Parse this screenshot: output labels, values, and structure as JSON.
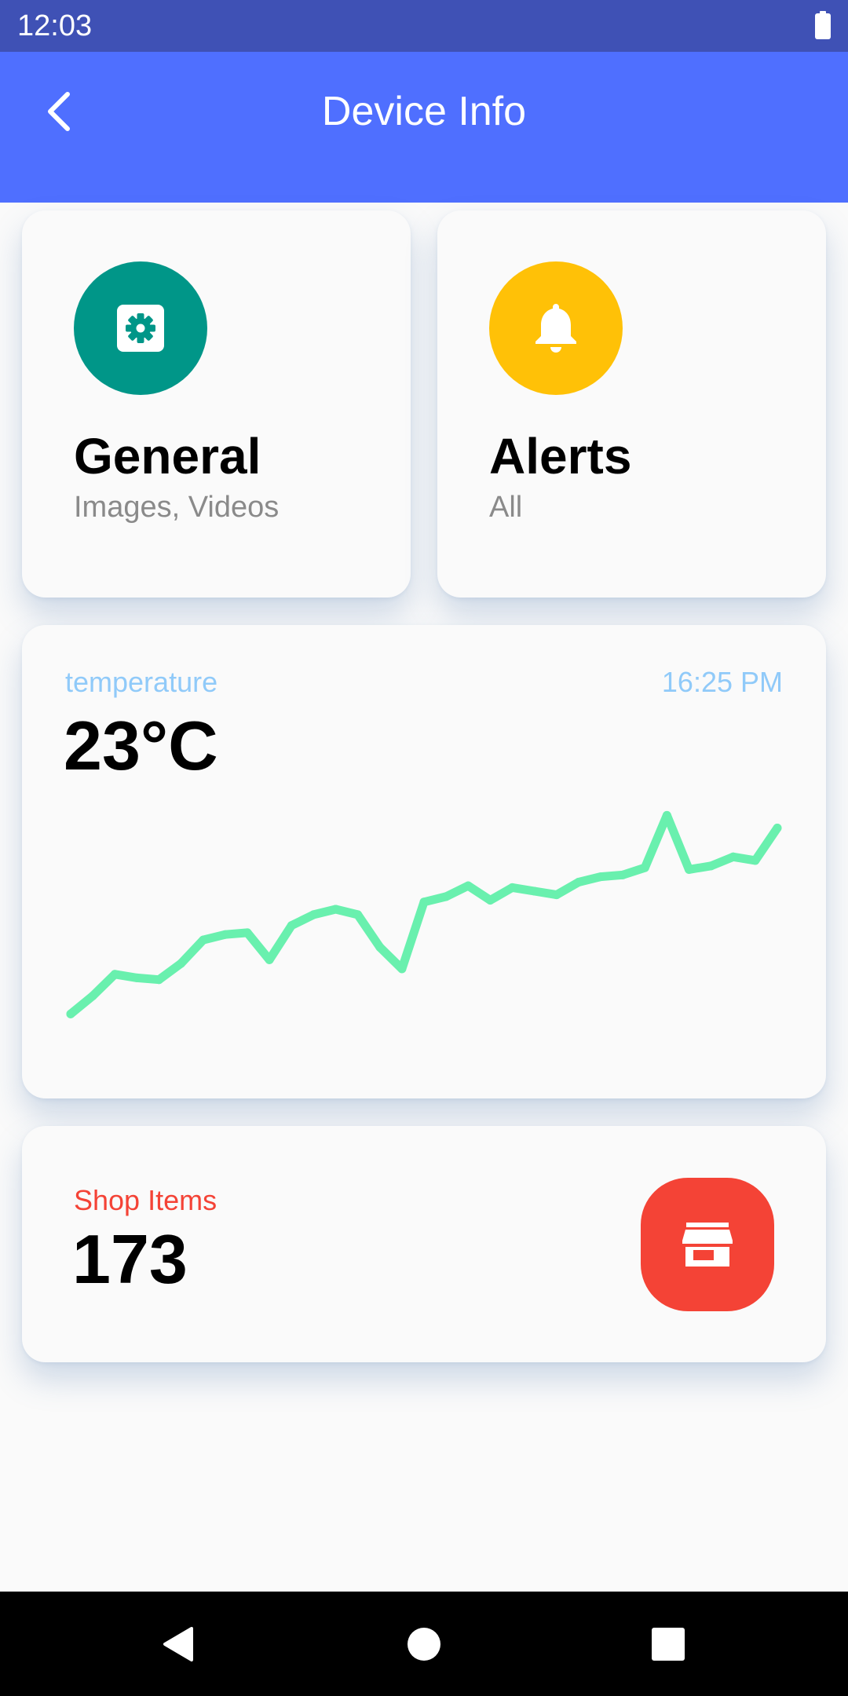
{
  "status_bar": {
    "time": "12:03",
    "battery_icon": "battery-full-icon"
  },
  "app_bar": {
    "title": "Device Info",
    "back_icon": "chevron-left-icon",
    "background_color": "#4F6FFF"
  },
  "cards": {
    "general": {
      "title": "General",
      "subtitle": "Images, Videos",
      "icon": "settings-gear-icon",
      "icon_bg_color": "#009688"
    },
    "alerts": {
      "title": "Alerts",
      "subtitle": "All",
      "icon": "bell-icon",
      "icon_bg_color": "#FFC107"
    }
  },
  "temperature": {
    "label": "temperature",
    "time": "16:25 PM",
    "value": "23°C",
    "line_color": "#69F0AE"
  },
  "chart_data": {
    "type": "line",
    "title": "",
    "xlabel": "",
    "ylabel": "",
    "grid": false,
    "series": [
      {
        "values": [
          2,
          12,
          24,
          22,
          21,
          30,
          43,
          46,
          47,
          32,
          51,
          57,
          60,
          57,
          39,
          27,
          64,
          67,
          73,
          65,
          72,
          70,
          68,
          75,
          78,
          79,
          83,
          112,
          82,
          84,
          89,
          87,
          105
        ]
      }
    ],
    "ylim": [
      0,
      120
    ]
  },
  "shop": {
    "label": "Shop Items",
    "count": "173",
    "icon": "store-icon",
    "button_color": "#F44336"
  },
  "nav_bar": {
    "back_icon": "nav-back-triangle-icon",
    "home_icon": "nav-home-circle-icon",
    "recents_icon": "nav-recents-square-icon"
  }
}
